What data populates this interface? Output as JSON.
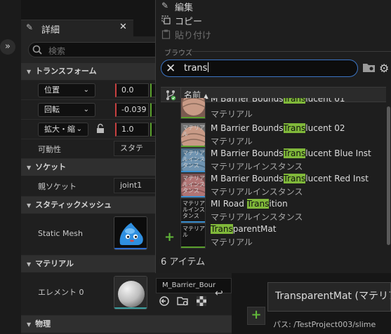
{
  "context_menu": {
    "edit": "編集",
    "copy": "コピー",
    "paste": "貼り付け"
  },
  "details": {
    "tab_title": "詳細",
    "search_placeholder": "検索",
    "categories": {
      "transform": "トランスフォーム",
      "socket": "ソケット",
      "static_mesh": "スタティックメッシュ",
      "material": "マテリアル",
      "physics": "物理"
    },
    "location": {
      "label": "位置",
      "x": "0.0"
    },
    "rotation": {
      "label": "回転",
      "x": "-0.039"
    },
    "scale": {
      "label": "拡大・縮",
      "x": "1.0"
    },
    "mobility": {
      "label": "可動性",
      "value": "スタテ"
    },
    "parent_socket": {
      "label": "親ソケット",
      "value": "joint1"
    },
    "static_mesh": {
      "label": "Static Mesh"
    },
    "element0": {
      "label": "エレメント 0",
      "value": "M_Barrier_Bour"
    }
  },
  "picker": {
    "browse_label": "ブラウズ",
    "search_value": "trans",
    "name_column": "名前",
    "item_count": "6 アイテム",
    "assets": [
      {
        "pre": "M Barrier Bounds",
        "match": "Trans",
        "post": "lucent 01",
        "type": "マテリアル",
        "thumb_label": ""
      },
      {
        "pre": "M Barrier Bounds",
        "match": "Trans",
        "post": "lucent 02",
        "type": "マテリアル",
        "thumb_label": "マテリアル"
      },
      {
        "pre": "M Barrier Bounds",
        "match": "Trans",
        "post": "lucent Blue Inst",
        "type": "マテリアルインスタンス",
        "thumb_label": "マテリアルインスタンス"
      },
      {
        "pre": "M Barrier Bounds",
        "match": "Trans",
        "post": "lucent Red Inst",
        "type": "マテリアルインスタンス",
        "thumb_label": "マテリアルインスタンス"
      },
      {
        "pre": "MI Road ",
        "match": "Trans",
        "post": "ition",
        "type": "マテリアルインスタンス",
        "thumb_label": "マテリアルインスタンス"
      },
      {
        "pre": "",
        "match": "Trans",
        "post": "parentMat",
        "type": "マテリアル",
        "thumb_label": "マテリアル"
      }
    ]
  },
  "content_browser": {
    "selected_title": "TransparentMat (マテリア",
    "path": "パス: /TestProject003/slime"
  },
  "colors": {
    "highlight": "#80b83a",
    "search_border": "#3b74c4",
    "add_green": "#62b83a"
  }
}
